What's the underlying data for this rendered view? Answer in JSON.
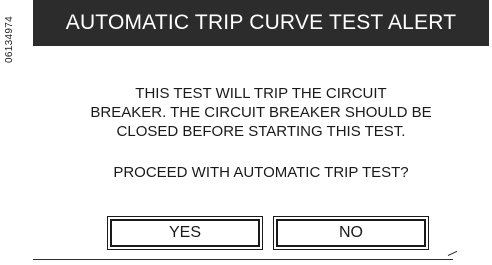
{
  "figure_code": "06134974",
  "dialog": {
    "title": "AUTOMATIC TRIP CURVE TEST ALERT",
    "message_lines": [
      "THIS TEST WILL TRIP THE CIRCUIT",
      "BREAKER. THE CIRCUIT BREAKER SHOULD BE",
      "CLOSED BEFORE STARTING THIS TEST."
    ],
    "prompt": "PROCEED WITH AUTOMATIC TRIP TEST?",
    "yes_label": "YES",
    "no_label": "NO"
  },
  "colors": {
    "title_bar_bg": "#2c2c2c",
    "title_text": "#ffffff",
    "text": "#1a1a1a",
    "background": "#ffffff"
  }
}
